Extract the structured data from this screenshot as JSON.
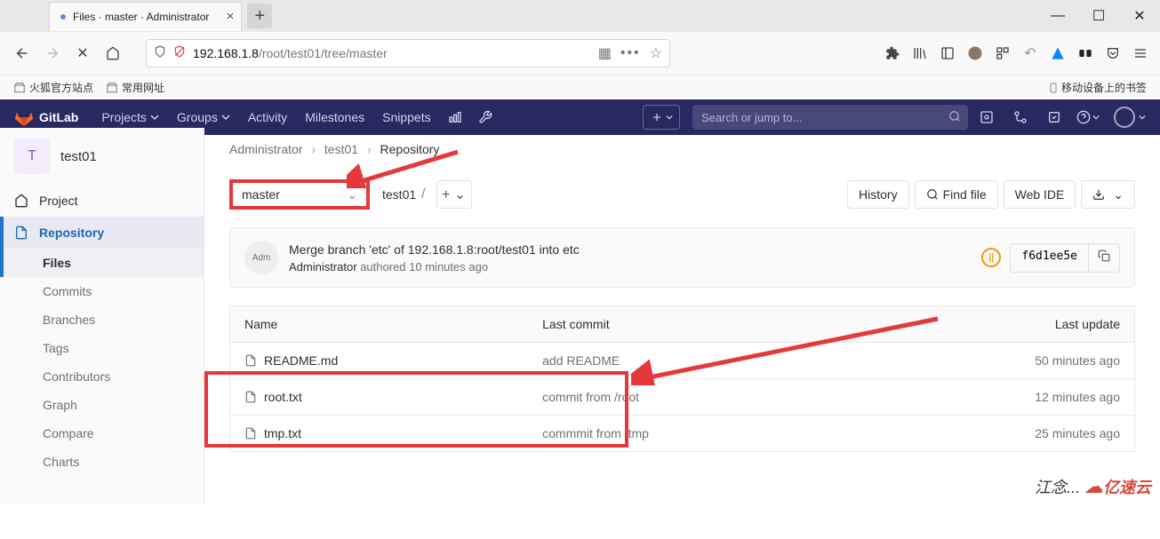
{
  "browser": {
    "tab_title": "Files · master · Administrator",
    "url_prefix": "192.168.1.8",
    "url_path": "/root/test01/tree/master",
    "bookmarks": {
      "firefox": "火狐官方站点",
      "common": "常用网址",
      "mobile": "移动设备上的书签"
    }
  },
  "gitlab": {
    "brand": "GitLab",
    "nav": {
      "projects": "Projects",
      "groups": "Groups",
      "activity": "Activity",
      "milestones": "Milestones",
      "snippets": "Snippets"
    },
    "search_placeholder": "Search or jump to..."
  },
  "sidebar": {
    "project_initial": "T",
    "project_name": "test01",
    "project_label": "Project",
    "repository_label": "Repository",
    "subs": [
      "Files",
      "Commits",
      "Branches",
      "Tags",
      "Contributors",
      "Graph",
      "Compare",
      "Charts"
    ]
  },
  "breadcrumb": {
    "owner": "Administrator",
    "project": "test01",
    "page": "Repository"
  },
  "toolbar": {
    "branch": "master",
    "path_root": "test01",
    "history": "History",
    "find_file": "Find file",
    "web_ide": "Web IDE"
  },
  "commit": {
    "avatar_text": "Adm",
    "message": "Merge branch 'etc' of 192.168.1.8:root/test01 into etc",
    "author": "Administrator",
    "authored_word": "authored",
    "time": "10 minutes ago",
    "sha": "f6d1ee5e",
    "pipeline": "||"
  },
  "table": {
    "headers": {
      "name": "Name",
      "last_commit": "Last commit",
      "last_update": "Last update"
    },
    "rows": [
      {
        "name": "README.md",
        "commit": "add README",
        "update": "50 minutes ago"
      },
      {
        "name": "root.txt",
        "commit": "commit from /root",
        "update": "12 minutes ago"
      },
      {
        "name": "tmp.txt",
        "commit": "commmit from /tmp",
        "update": "25 minutes ago"
      }
    ]
  },
  "watermark": {
    "text": "江念...",
    "brand": "亿速云"
  }
}
